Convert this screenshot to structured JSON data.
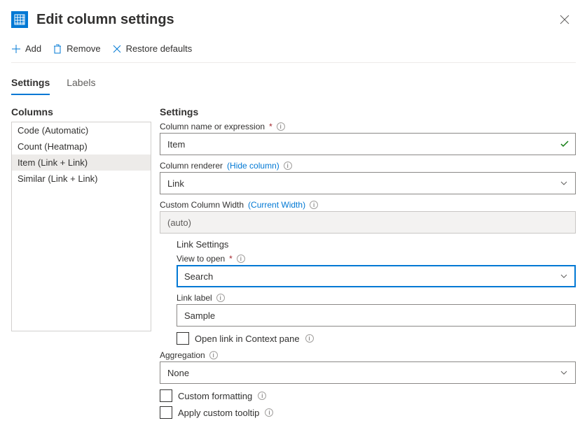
{
  "header": {
    "title": "Edit column settings"
  },
  "toolbar": {
    "add": "Add",
    "remove": "Remove",
    "restore": "Restore defaults"
  },
  "tabs": {
    "settings": "Settings",
    "labels": "Labels"
  },
  "columns": {
    "title": "Columns",
    "items": [
      "Code (Automatic)",
      "Count (Heatmap)",
      "Item (Link + Link)",
      "Similar (Link + Link)"
    ],
    "selected_index": 2
  },
  "settingsForm": {
    "title": "Settings",
    "columnName": {
      "label": "Column name or expression",
      "value": "Item"
    },
    "renderer": {
      "label": "Column renderer",
      "hint": "(Hide column)",
      "value": "Link"
    },
    "width": {
      "label": "Custom Column Width",
      "hint": "(Current Width)",
      "value": "(auto)"
    },
    "linkSettings": {
      "title": "Link Settings",
      "viewToOpen": {
        "label": "View to open",
        "value": "Search"
      },
      "linkLabel": {
        "label": "Link label",
        "value": "Sample"
      },
      "openContext": {
        "label": "Open link in Context pane"
      }
    },
    "aggregation": {
      "label": "Aggregation",
      "value": "None"
    },
    "customFormatting": {
      "label": "Custom formatting"
    },
    "customTooltip": {
      "label": "Apply custom tooltip"
    }
  }
}
